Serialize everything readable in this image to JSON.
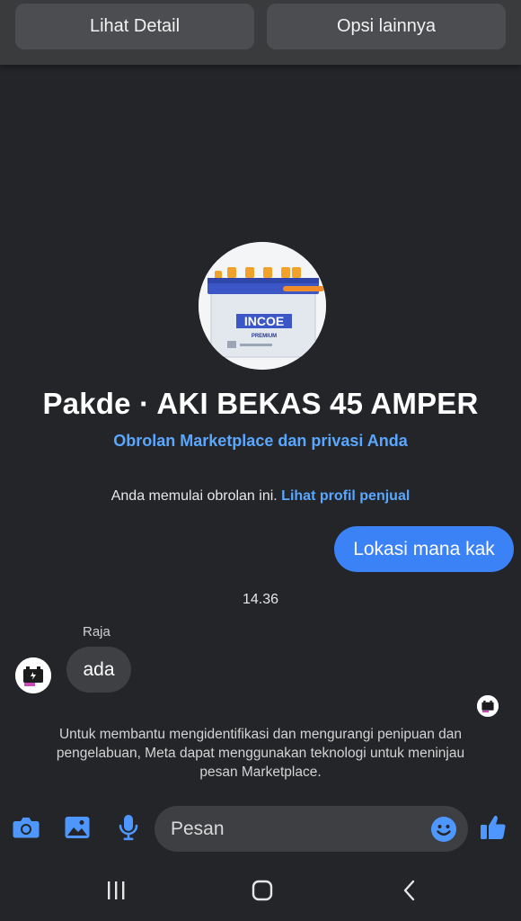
{
  "top_actions": {
    "detail_label": "Lihat Detail",
    "more_label": "Opsi lainnya"
  },
  "header": {
    "product_image_icon": "car-battery-photo",
    "title": "Pakde · AKI BEKAS 45 AMPER",
    "privacy_link": "Obrolan Marketplace dan privasi Anda"
  },
  "conversation": {
    "started_text": "Anda memulai obrolan ini.",
    "seller_profile_link": "Lihat profil penjual",
    "messages": [
      {
        "direction": "outgoing",
        "text": "Lokasi mana kak"
      },
      {
        "direction": "incoming",
        "sender": "Raja",
        "text": "ada"
      }
    ],
    "timestamp": "14.36",
    "notice": "Untuk membantu mengidentifikasi dan mengurangi penipuan dan pengelabuan, Meta dapat menggunakan teknologi untuk meninjau pesan Marketplace."
  },
  "composer": {
    "placeholder": "Pesan",
    "icons": [
      "camera-icon",
      "gallery-icon",
      "microphone-icon",
      "emoji-icon",
      "thumbs-up-icon"
    ]
  },
  "navigation": {
    "icons": [
      "recent-apps-icon",
      "home-icon",
      "back-icon"
    ]
  },
  "colors": {
    "background": "#232528",
    "accent_blue": "#3b82f6",
    "link_blue": "#5aa7ff",
    "incoming_bubble": "#3e4044"
  },
  "product_image": {
    "brand_text": "INCOE",
    "sub_text": "PREMIUM"
  }
}
